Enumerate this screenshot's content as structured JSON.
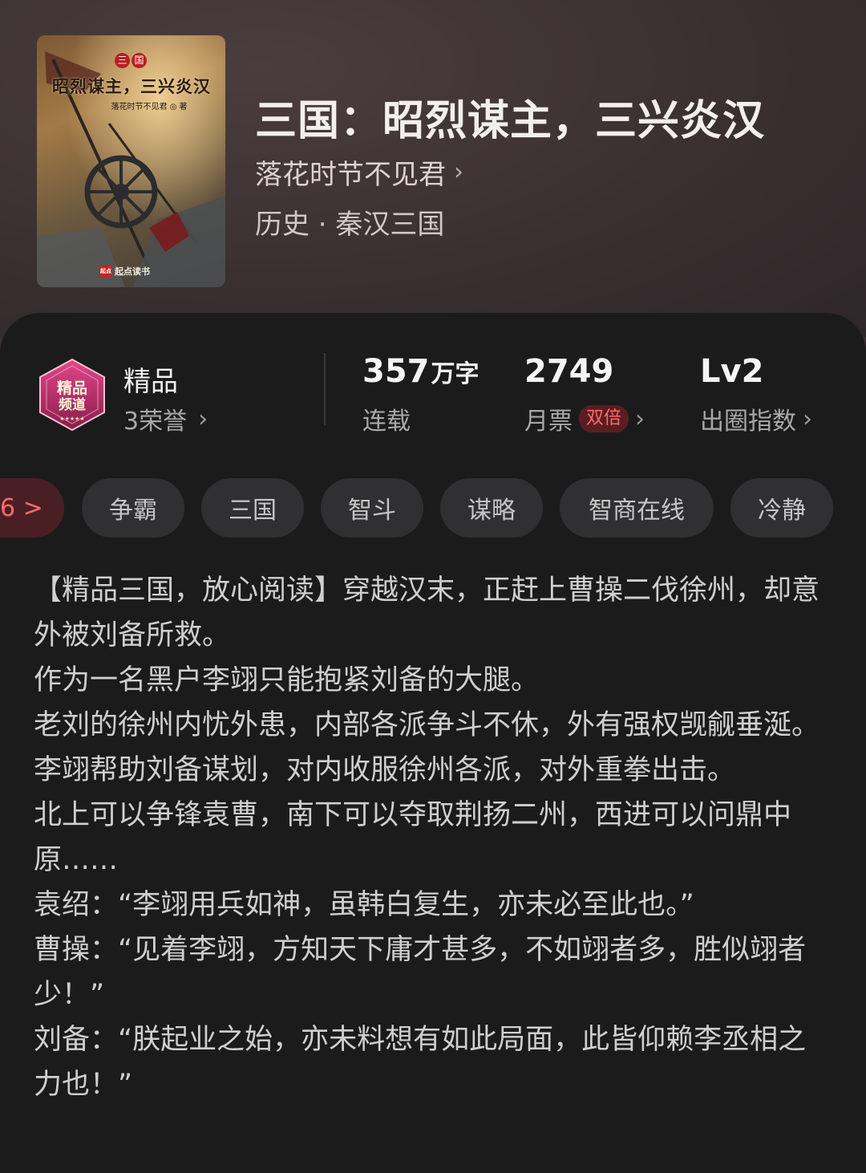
{
  "book": {
    "title": "三国：昭烈谋主，三兴炎汉",
    "author": "落花时节不见君",
    "category": "历史 · 秦汉三国",
    "cover": {
      "series_chars": [
        "三",
        "国"
      ],
      "title": "昭烈谋主，三兴炎汉",
      "author_line": "落花时节不见君 ◎ 著",
      "publisher": "起点读书",
      "publisher_logo": "起点"
    }
  },
  "badge": {
    "icon_text": "精品频道",
    "label": "精品",
    "honor": "3荣誉"
  },
  "stats": {
    "words_value": "357",
    "words_unit": "万字",
    "words_label": "连载",
    "monthly_value": "2749",
    "monthly_label": "月票",
    "monthly_badge": "双倍",
    "level_value": "Lv2",
    "level_label": "出圈指数"
  },
  "tags": [
    "6 >",
    "争霸",
    "三国",
    "智斗",
    "谋略",
    "智商在线",
    "冷静"
  ],
  "synopsis": [
    "【精品三国，放心阅读】穿越汉末，正赶上曹操二伐徐州，却意外被刘备所救。",
    "作为一名黑户李翊只能抱紧刘备的大腿。",
    "老刘的徐州内忧外患，内部各派争斗不休，外有强权觊觎垂涎。",
    "李翊帮助刘备谋划，对内收服徐州各派，对外重拳出击。",
    "北上可以争锋袁曹，南下可以夺取荆扬二州，西进可以问鼎中原……",
    "袁绍：“李翊用兵如神，虽韩白复生，亦未必至此也。”",
    "曹操：“见着李翊，方知天下庸才甚多，不如翊者多，胜似翊者少！”",
    "刘备：“朕起业之始，亦未料想有如此局面，此皆仰赖李丞相之力也！”"
  ],
  "icons": {
    "chevron": "chevron-right-icon",
    "badge": "premium-channel-badge-icon"
  },
  "colors": {
    "accent_red": "#ff6b6b",
    "card_bg": "#1b1b1c",
    "tag_bg": "#303032"
  }
}
